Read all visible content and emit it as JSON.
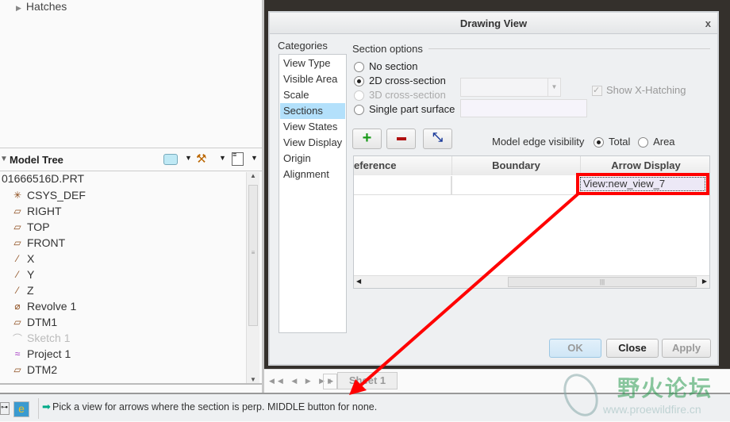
{
  "left_panel": {
    "hatches_label": "Hatches",
    "model_tree": {
      "title": "Model Tree",
      "root": "01666516D.PRT",
      "items": [
        {
          "label": "CSYS_DEF",
          "icon": "csys-icon",
          "disabled": false
        },
        {
          "label": "RIGHT",
          "icon": "datum-plane-icon",
          "disabled": false
        },
        {
          "label": "TOP",
          "icon": "datum-plane-icon",
          "disabled": false
        },
        {
          "label": "FRONT",
          "icon": "datum-plane-icon",
          "disabled": false
        },
        {
          "label": "X",
          "icon": "datum-axis-icon",
          "disabled": false
        },
        {
          "label": "Y",
          "icon": "datum-axis-icon",
          "disabled": false
        },
        {
          "label": "Z",
          "icon": "datum-axis-icon",
          "disabled": false
        },
        {
          "label": "Revolve 1",
          "icon": "revolve-icon",
          "disabled": false
        },
        {
          "label": "DTM1",
          "icon": "datum-plane-icon",
          "disabled": false
        },
        {
          "label": "Sketch 1",
          "icon": "sketch-icon",
          "disabled": true
        },
        {
          "label": "Project 1",
          "icon": "project-icon",
          "disabled": false
        },
        {
          "label": "DTM2",
          "icon": "datum-plane-icon",
          "disabled": false
        }
      ]
    }
  },
  "dialog": {
    "title": "Drawing View",
    "close_label": "x",
    "categories_label": "Categories",
    "categories": [
      "View Type",
      "Visible Area",
      "Scale",
      "Sections",
      "View States",
      "View Display",
      "Origin",
      "Alignment"
    ],
    "selected_category": "Sections",
    "section_options_label": "Section options",
    "options": [
      {
        "label": "No section",
        "selected": false,
        "disabled": false
      },
      {
        "label": "2D cross-section",
        "selected": true,
        "disabled": false
      },
      {
        "label": "3D cross-section",
        "selected": false,
        "disabled": true
      },
      {
        "label": "Single part surface",
        "selected": false,
        "disabled": false
      }
    ],
    "show_xhatching_label": "Show X-Hatching",
    "model_edge_label": "Model edge visibility",
    "edge_total": "Total",
    "edge_area": "Area",
    "columns": [
      "eference",
      "Boundary",
      "Arrow Display"
    ],
    "row": {
      "reference": "",
      "boundary": "",
      "arrow_display": "View:new_view_7"
    },
    "ok_label": "OK",
    "close_button_label": "Close",
    "apply_label": "Apply"
  },
  "sheet_tab": "Sheet 1",
  "sheet_add": "+",
  "status_message": "Pick a view for arrows where the section is perp. MIDDLE button for none.",
  "watermark": {
    "text_cn": "野火论坛",
    "url": "www.proewildfire.cn"
  },
  "colors": {
    "highlight": "#ff0000",
    "selected_category": "#b3e0fb"
  }
}
